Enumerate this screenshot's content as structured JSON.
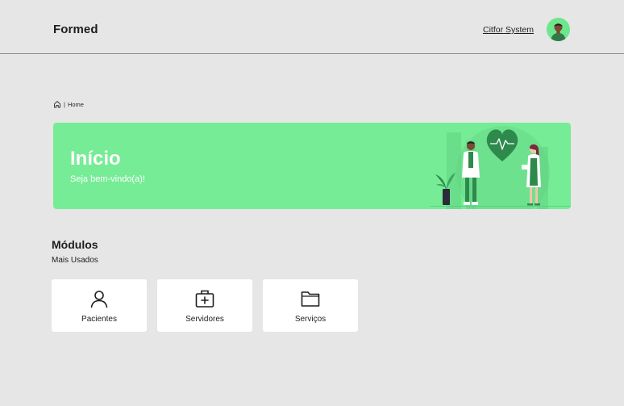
{
  "header": {
    "brand": "Formed",
    "user_name": "Citfor System",
    "avatar_icon": "user-avatar-icon"
  },
  "breadcrumb": {
    "home_icon": "home-icon",
    "separator": "|",
    "current": "Home"
  },
  "banner": {
    "title": "Início",
    "subtitle": "Seja bem-vindo(a)!",
    "illustration": "doctors-heart-illustration",
    "background_color": "#76ec96"
  },
  "modules": {
    "title": "Módulos",
    "subtitle": "Mais Usados",
    "items": [
      {
        "label": "Pacientes",
        "icon": "user-icon"
      },
      {
        "label": "Servidores",
        "icon": "medical-kit-icon"
      },
      {
        "label": "Serviços",
        "icon": "folder-icon"
      }
    ]
  },
  "colors": {
    "background": "#e6e6e6",
    "accent": "#76ec96",
    "text": "#1e1e1e"
  }
}
